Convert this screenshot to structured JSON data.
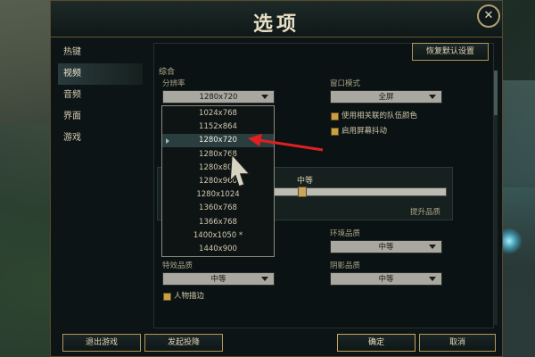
{
  "window": {
    "title": "选项",
    "close_glyph": "✕"
  },
  "sidebar": {
    "items": [
      {
        "label": "热键",
        "active": false
      },
      {
        "label": "视频",
        "active": true
      },
      {
        "label": "音频",
        "active": false
      },
      {
        "label": "界面",
        "active": false
      },
      {
        "label": "游戏",
        "active": false
      }
    ]
  },
  "toolbar": {
    "restore_defaults": "恢复默认设置"
  },
  "general": {
    "section_label": "综合",
    "resolution": {
      "label": "分辨率",
      "value": "1280x720"
    },
    "window_mode": {
      "label": "窗口模式",
      "value": "全屏"
    },
    "checkboxes": [
      {
        "label": "使用相关联的队伍颜色",
        "checked": true
      },
      {
        "label": "启用屏幕抖动",
        "checked": true
      }
    ]
  },
  "dropdown": {
    "options": [
      "1024x768",
      "1152x864",
      "1280x720",
      "1280x768",
      "1280x800",
      "1280x960",
      "1280x1024",
      "1360x768",
      "1366x768",
      "1400x1050 *",
      "1440x900"
    ],
    "selected": "1280x720"
  },
  "quality": {
    "slider_value_label": "中等",
    "slider_fraction": 0.5,
    "hint": "提升品质"
  },
  "environment": {
    "label": "环境品质",
    "value": "中等"
  },
  "effects": {
    "label": "特效品质",
    "value": "中等"
  },
  "shadows": {
    "label": "阴影品质",
    "value": "中等"
  },
  "outline": {
    "label": "人物描边",
    "checked": true
  },
  "footer": {
    "exit": "退出游戏",
    "surrender": "发起投降",
    "ok": "确定",
    "cancel": "取消"
  },
  "colors": {
    "accent": "#c9a45a",
    "annotation_arrow": "#e02020"
  },
  "icons": {
    "close": "close-icon",
    "dropdown": "chevron-down-icon",
    "cursor": "mouse-cursor-icon"
  }
}
